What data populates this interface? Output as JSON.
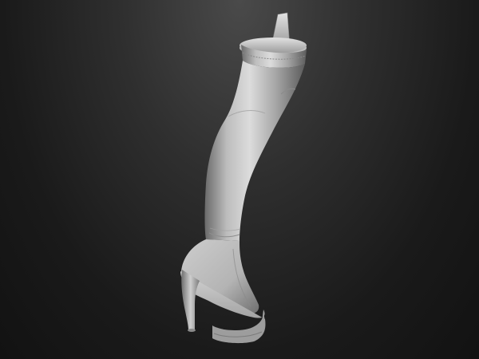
{
  "scene": {
    "subject": "sculpted-thigh-high-platform-boot",
    "render_style": "matcap-clay-gray",
    "colors": {
      "background_top": "#4a4a4a",
      "background_bottom": "#121212",
      "clay_light": "#d8d8d8",
      "clay_mid": "#a9a9a9",
      "clay_dark": "#5e5e5e"
    }
  }
}
